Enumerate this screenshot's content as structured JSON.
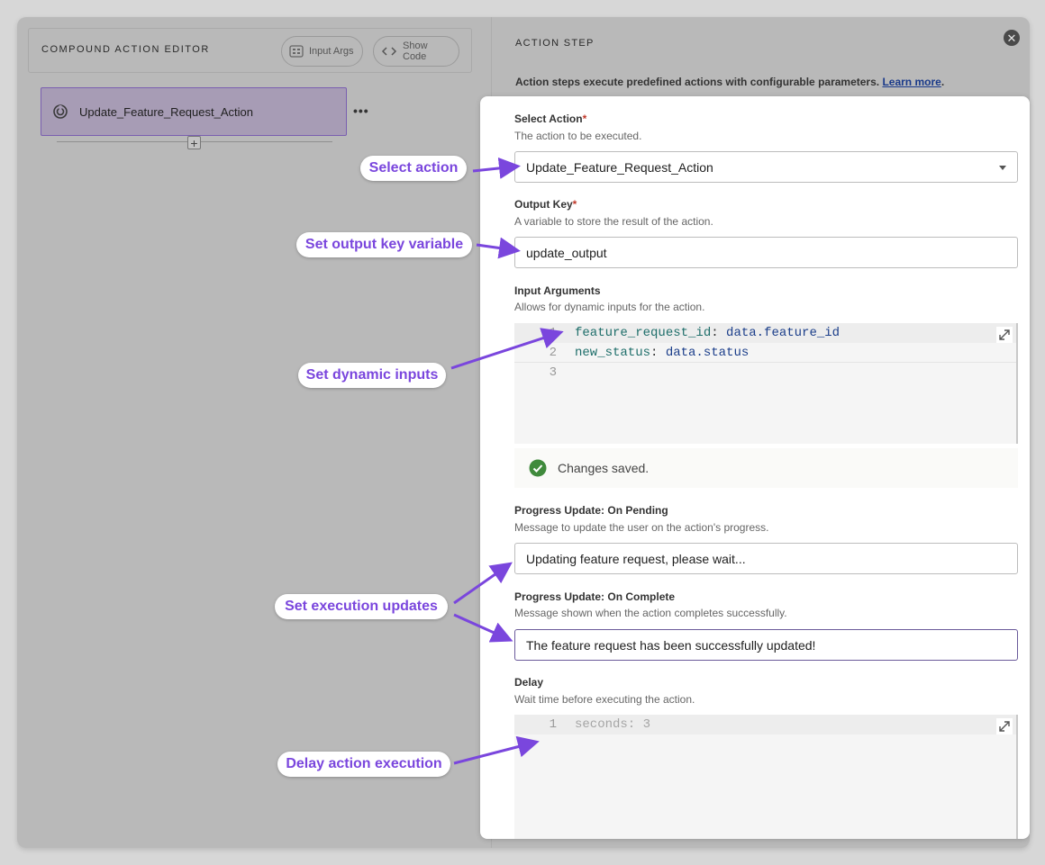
{
  "editor": {
    "title": "COMPOUND ACTION EDITOR",
    "input_args_label": "Input Args",
    "show_code_label": "Show Code",
    "node_label": "Update_Feature_Request_Action",
    "node_menu": "•••",
    "add_symbol": "+"
  },
  "step": {
    "title": "ACTION STEP",
    "description": "Action steps execute predefined actions with configurable parameters.",
    "learn_more": "Learn more",
    "period": "."
  },
  "fields": {
    "select_action": {
      "label": "Select Action",
      "required_mark": "*",
      "help": "The action to be executed.",
      "value": "Update_Feature_Request_Action"
    },
    "output_key": {
      "label": "Output Key",
      "required_mark": "*",
      "help": "A variable to store the result of the action.",
      "value": "update_output"
    },
    "input_arguments": {
      "label": "Input Arguments",
      "help": "Allows for dynamic inputs for the action.",
      "lines": [
        {
          "num": "1",
          "key": "feature_request_id",
          "sep": ": ",
          "value": "data.feature_id"
        },
        {
          "num": "2",
          "key": "new_status",
          "sep": ": ",
          "value": "data.status"
        },
        {
          "num": "3",
          "key": "",
          "sep": "",
          "value": ""
        }
      ],
      "saved_message": "Changes saved."
    },
    "progress_pending": {
      "label": "Progress Update: On Pending",
      "help": "Message to update the user on the action's progress.",
      "value": "Updating feature request, please wait..."
    },
    "progress_complete": {
      "label": "Progress Update: On Complete",
      "help": "Message shown when the action completes successfully.",
      "value": "The feature request has been successfully updated!"
    },
    "delay": {
      "label": "Delay",
      "help": "Wait time before executing the action.",
      "lines": [
        {
          "num": "1",
          "text": "seconds: 3"
        }
      ]
    }
  },
  "annotations": {
    "select_action": "Select action",
    "output_key": "Set output key variable",
    "dynamic_inputs": "Set dynamic inputs",
    "execution_updates": "Set execution updates",
    "delay": "Delay action execution"
  },
  "colors": {
    "annotation_accent": "#7a46dd",
    "node_fill": "#a79cb5",
    "node_border": "#7a5fb0",
    "success_green": "#3f8a3c"
  }
}
